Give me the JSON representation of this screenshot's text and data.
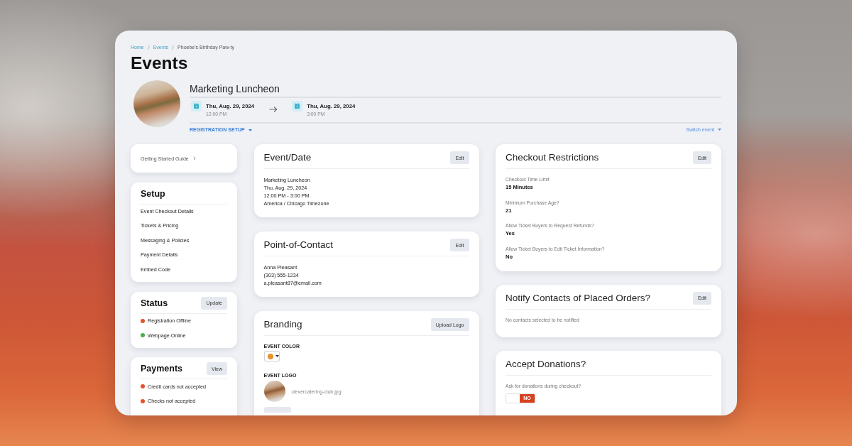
{
  "breadcrumb": [
    {
      "kind": "link",
      "label": "Home"
    },
    {
      "kind": "link",
      "label": "Events"
    },
    {
      "kind": "current",
      "label": "Phoebe's Birthday Paw-ty"
    }
  ],
  "page_title": "Events",
  "event": {
    "name": "Marketing Luncheon",
    "start": {
      "date": "Thu, Aug. 29, 2024",
      "time": "12:00 PM"
    },
    "end": {
      "date": "Thu, Aug. 29, 2024",
      "time": "3:00 PM"
    },
    "setup_menu": "REGISTRATION SETUP",
    "switch_event": "Switch event"
  },
  "columns": [
    {
      "cards": [
        {
          "kind": "link",
          "label": "Getting Started Guide"
        },
        {
          "kind": "menu",
          "title": "Setup",
          "items": [
            "Event Checkout Details",
            "Tickets & Pricing",
            "Messaging & Policies",
            "Payment Details",
            "Embed Code"
          ]
        },
        {
          "kind": "status",
          "title": "Status",
          "button": "Update",
          "items": [
            {
              "label": "Registration Offline",
              "color": "#e4532d"
            },
            {
              "label": "Webpage Online",
              "color": "#4caf50"
            }
          ]
        },
        {
          "kind": "status",
          "title": "Payments",
          "button": "View",
          "items": [
            {
              "label": "Credit cards not accepted",
              "color": "#e4532d"
            },
            {
              "label": "Checks not accepted",
              "color": "#e4532d"
            }
          ]
        }
      ]
    },
    {
      "cards": [
        {
          "kind": "lines",
          "title": "Event/Date",
          "button": "Edit",
          "lines": [
            "Marketing Luncheon",
            "Thu, Aug. 29, 2024",
            "12:00 PM - 3:00 PM",
            "America / Chicago Timezone"
          ]
        },
        {
          "kind": "lines",
          "title": "Point-of-Contact",
          "button": "Edit",
          "lines": [
            "Anna Pleasant",
            "(303) 555-1234",
            "a.pleasant87@email.com"
          ]
        },
        {
          "kind": "branding",
          "title": "Branding",
          "button": "Upload Logo",
          "color_label": "EVENT COLOR",
          "logo_label": "EVENT LOGO",
          "logo_file": "clevercatering-club.jpg"
        }
      ]
    },
    {
      "cards": [
        {
          "kind": "fields",
          "title": "Checkout Restrictions",
          "button": "Edit",
          "fields": [
            {
              "label": "Checkout Time Limit",
              "value": "15 Minutes"
            },
            {
              "label": "Minimum Purchase Age?",
              "value": "21"
            },
            {
              "label": "Allow Ticket Buyers to Request Refunds?",
              "value": "Yes"
            },
            {
              "label": "Allow Ticket Buyers to Edit Ticket Information?",
              "value": "No"
            }
          ]
        },
        {
          "kind": "note",
          "title": "Notify Contacts of Placed Orders?",
          "button": "Edit",
          "text": "No contacts selected to be notified"
        },
        {
          "kind": "toggle",
          "title": "Accept Donations?",
          "question": "Ask for donations during checkout?",
          "toggle": {
            "on": false,
            "label": "NO"
          }
        }
      ]
    }
  ]
}
